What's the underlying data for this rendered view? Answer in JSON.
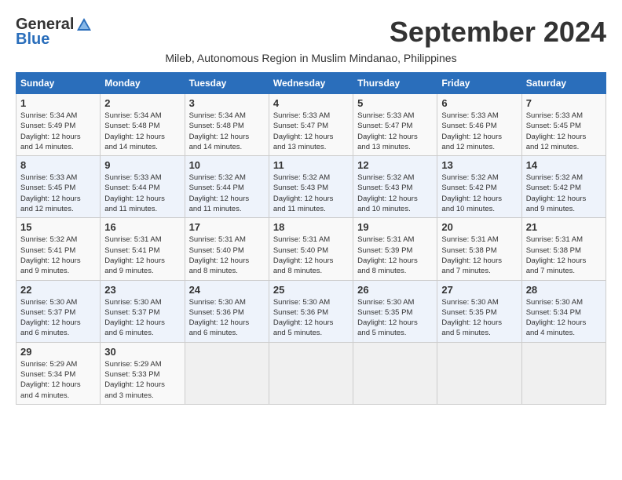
{
  "header": {
    "logo_general": "General",
    "logo_blue": "Blue",
    "month_title": "September 2024",
    "subtitle": "Mileb, Autonomous Region in Muslim Mindanao, Philippines"
  },
  "calendar": {
    "weekdays": [
      "Sunday",
      "Monday",
      "Tuesday",
      "Wednesday",
      "Thursday",
      "Friday",
      "Saturday"
    ],
    "weeks": [
      [
        {
          "day": "",
          "empty": true
        },
        {
          "day": "",
          "empty": true
        },
        {
          "day": "",
          "empty": true
        },
        {
          "day": "",
          "empty": true
        },
        {
          "day": "",
          "empty": true
        },
        {
          "day": "",
          "empty": true
        },
        {
          "day": "",
          "empty": true
        }
      ],
      [
        {
          "day": "1",
          "sunrise": "5:34 AM",
          "sunset": "5:49 PM",
          "daylight": "12 hours and 14 minutes."
        },
        {
          "day": "2",
          "sunrise": "5:34 AM",
          "sunset": "5:48 PM",
          "daylight": "12 hours and 14 minutes."
        },
        {
          "day": "3",
          "sunrise": "5:34 AM",
          "sunset": "5:48 PM",
          "daylight": "12 hours and 14 minutes."
        },
        {
          "day": "4",
          "sunrise": "5:33 AM",
          "sunset": "5:47 PM",
          "daylight": "12 hours and 13 minutes."
        },
        {
          "day": "5",
          "sunrise": "5:33 AM",
          "sunset": "5:47 PM",
          "daylight": "12 hours and 13 minutes."
        },
        {
          "day": "6",
          "sunrise": "5:33 AM",
          "sunset": "5:46 PM",
          "daylight": "12 hours and 12 minutes."
        },
        {
          "day": "7",
          "sunrise": "5:33 AM",
          "sunset": "5:45 PM",
          "daylight": "12 hours and 12 minutes."
        }
      ],
      [
        {
          "day": "8",
          "sunrise": "5:33 AM",
          "sunset": "5:45 PM",
          "daylight": "12 hours and 12 minutes."
        },
        {
          "day": "9",
          "sunrise": "5:33 AM",
          "sunset": "5:44 PM",
          "daylight": "12 hours and 11 minutes."
        },
        {
          "day": "10",
          "sunrise": "5:32 AM",
          "sunset": "5:44 PM",
          "daylight": "12 hours and 11 minutes."
        },
        {
          "day": "11",
          "sunrise": "5:32 AM",
          "sunset": "5:43 PM",
          "daylight": "12 hours and 11 minutes."
        },
        {
          "day": "12",
          "sunrise": "5:32 AM",
          "sunset": "5:43 PM",
          "daylight": "12 hours and 10 minutes."
        },
        {
          "day": "13",
          "sunrise": "5:32 AM",
          "sunset": "5:42 PM",
          "daylight": "12 hours and 10 minutes."
        },
        {
          "day": "14",
          "sunrise": "5:32 AM",
          "sunset": "5:42 PM",
          "daylight": "12 hours and 9 minutes."
        }
      ],
      [
        {
          "day": "15",
          "sunrise": "5:32 AM",
          "sunset": "5:41 PM",
          "daylight": "12 hours and 9 minutes."
        },
        {
          "day": "16",
          "sunrise": "5:31 AM",
          "sunset": "5:41 PM",
          "daylight": "12 hours and 9 minutes."
        },
        {
          "day": "17",
          "sunrise": "5:31 AM",
          "sunset": "5:40 PM",
          "daylight": "12 hours and 8 minutes."
        },
        {
          "day": "18",
          "sunrise": "5:31 AM",
          "sunset": "5:40 PM",
          "daylight": "12 hours and 8 minutes."
        },
        {
          "day": "19",
          "sunrise": "5:31 AM",
          "sunset": "5:39 PM",
          "daylight": "12 hours and 8 minutes."
        },
        {
          "day": "20",
          "sunrise": "5:31 AM",
          "sunset": "5:38 PM",
          "daylight": "12 hours and 7 minutes."
        },
        {
          "day": "21",
          "sunrise": "5:31 AM",
          "sunset": "5:38 PM",
          "daylight": "12 hours and 7 minutes."
        }
      ],
      [
        {
          "day": "22",
          "sunrise": "5:30 AM",
          "sunset": "5:37 PM",
          "daylight": "12 hours and 6 minutes."
        },
        {
          "day": "23",
          "sunrise": "5:30 AM",
          "sunset": "5:37 PM",
          "daylight": "12 hours and 6 minutes."
        },
        {
          "day": "24",
          "sunrise": "5:30 AM",
          "sunset": "5:36 PM",
          "daylight": "12 hours and 6 minutes."
        },
        {
          "day": "25",
          "sunrise": "5:30 AM",
          "sunset": "5:36 PM",
          "daylight": "12 hours and 5 minutes."
        },
        {
          "day": "26",
          "sunrise": "5:30 AM",
          "sunset": "5:35 PM",
          "daylight": "12 hours and 5 minutes."
        },
        {
          "day": "27",
          "sunrise": "5:30 AM",
          "sunset": "5:35 PM",
          "daylight": "12 hours and 5 minutes."
        },
        {
          "day": "28",
          "sunrise": "5:30 AM",
          "sunset": "5:34 PM",
          "daylight": "12 hours and 4 minutes."
        }
      ],
      [
        {
          "day": "29",
          "sunrise": "5:29 AM",
          "sunset": "5:34 PM",
          "daylight": "12 hours and 4 minutes."
        },
        {
          "day": "30",
          "sunrise": "5:29 AM",
          "sunset": "5:33 PM",
          "daylight": "12 hours and 3 minutes."
        },
        {
          "day": "",
          "empty": true
        },
        {
          "day": "",
          "empty": true
        },
        {
          "day": "",
          "empty": true
        },
        {
          "day": "",
          "empty": true
        },
        {
          "day": "",
          "empty": true
        }
      ]
    ]
  }
}
